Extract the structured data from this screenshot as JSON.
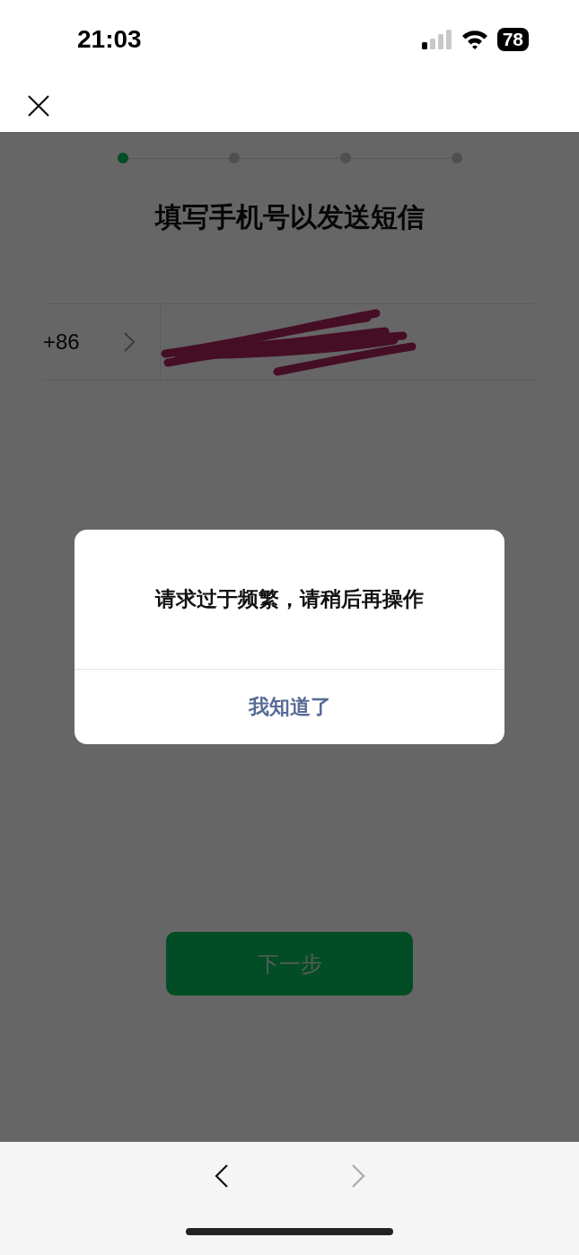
{
  "status_bar": {
    "time": "21:03",
    "battery": "78"
  },
  "steps": [
    {
      "selected": true
    },
    {
      "selected": false
    },
    {
      "selected": false
    },
    {
      "selected": false
    }
  ],
  "title": "填写手机号以发送短信",
  "phone": {
    "country_code": "+86",
    "redacted": true
  },
  "next_button": {
    "label": "下一步",
    "disabled": true
  },
  "dialog": {
    "message": "请求过于频繁，请稍后再操作",
    "button": "我知道了"
  },
  "bottom_bar": {
    "back_enabled": true,
    "forward_enabled": false
  }
}
